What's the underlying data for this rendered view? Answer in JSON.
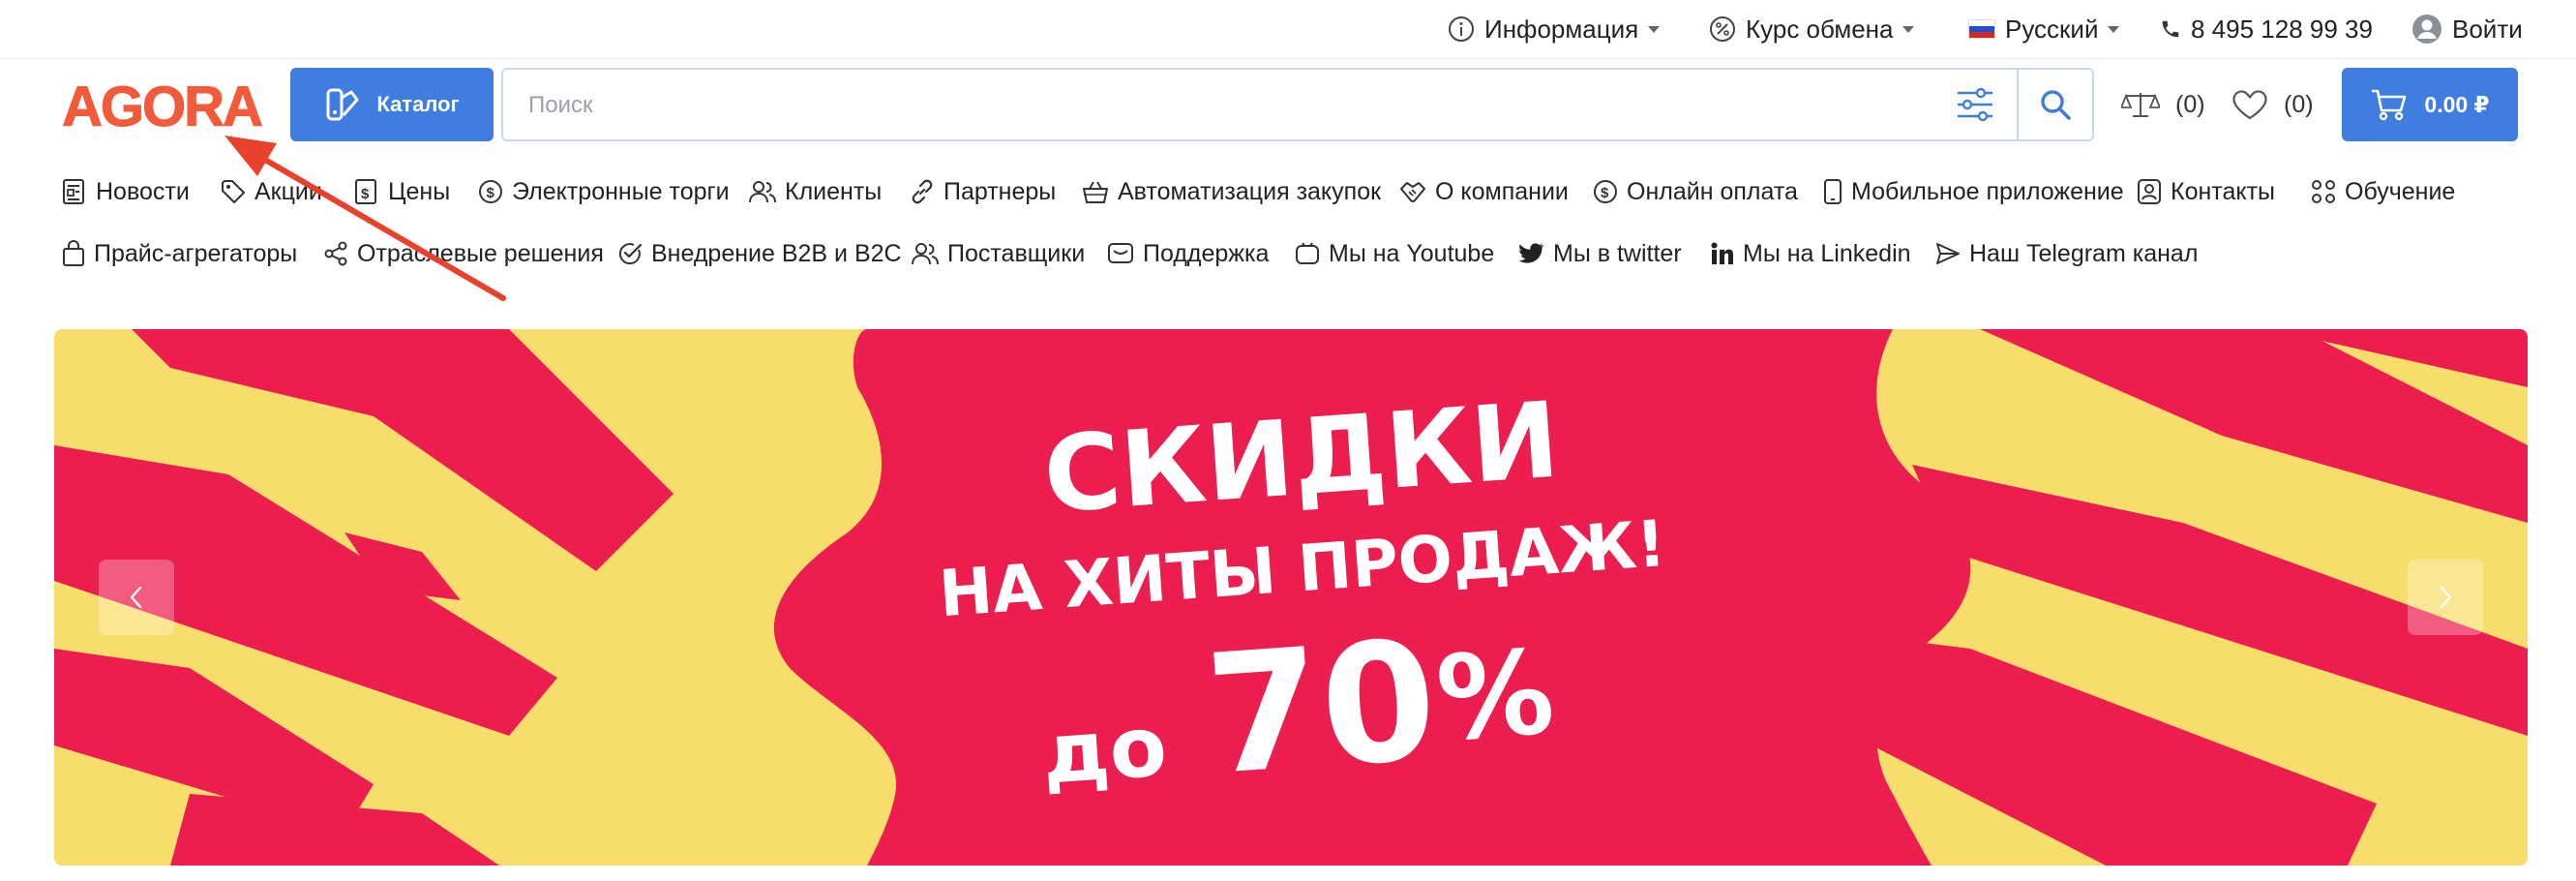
{
  "topbar": {
    "info_label": "Информация",
    "currency_label": "Курс обмена",
    "language_label": "Русский",
    "phone": "8 495 128 99 39",
    "login_label": "Войти"
  },
  "header": {
    "logo_text": "AGORA",
    "catalog_label": "Каталог",
    "search_placeholder": "Поиск",
    "compare_count": "(0)",
    "favorites_count": "(0)",
    "cart_total": "0.00 ₽"
  },
  "nav": {
    "row1": [
      {
        "label": "Новости",
        "icon": "news-icon"
      },
      {
        "label": "Акции",
        "icon": "tag-icon"
      },
      {
        "label": "Цены",
        "icon": "price-list-icon"
      },
      {
        "label": "Электронные торги",
        "icon": "dollar-circle-icon"
      },
      {
        "label": "Клиенты",
        "icon": "users-icon"
      },
      {
        "label": "Партнеры",
        "icon": "link-icon"
      },
      {
        "label": "Автоматизация закупок",
        "icon": "basket-icon"
      },
      {
        "label": "О компании",
        "icon": "handshake-icon"
      },
      {
        "label": "Онлайн оплата",
        "icon": "payment-icon"
      },
      {
        "label": "Мобильное приложение",
        "icon": "phone-icon"
      },
      {
        "label": "Контакты",
        "icon": "contact-card-icon"
      },
      {
        "label": "Обучение",
        "icon": "graduation-icon"
      }
    ],
    "row2": [
      {
        "label": "Прайс-агрегаторы",
        "icon": "bag-icon"
      },
      {
        "label": "Отраслевые решения",
        "icon": "share-icon"
      },
      {
        "label": "Внедрение B2B и B2C",
        "icon": "check-circle-icon"
      },
      {
        "label": "Поставщики",
        "icon": "users-icon"
      },
      {
        "label": "Поддержка",
        "icon": "chat-icon"
      },
      {
        "label": "Мы на Youtube",
        "icon": "youtube-icon"
      },
      {
        "label": "Мы в twitter",
        "icon": "twitter-icon"
      },
      {
        "label": "Мы на Linkedin",
        "icon": "linkedin-icon"
      },
      {
        "label": "Наш Telegram канал",
        "icon": "telegram-icon"
      }
    ]
  },
  "banner": {
    "line1": "СКИДКИ",
    "line2": "НА ХИТЫ ПРОДАЖ!",
    "line3_prefix": "до",
    "line3_value": "70",
    "line3_suffix": "%"
  },
  "colors": {
    "accent": "#3f7ee0",
    "logo": "#f25a3a",
    "banner_red": "#ec1e4f",
    "banner_yellow": "#f7de6c",
    "annotation_arrow": "#e8412c"
  }
}
